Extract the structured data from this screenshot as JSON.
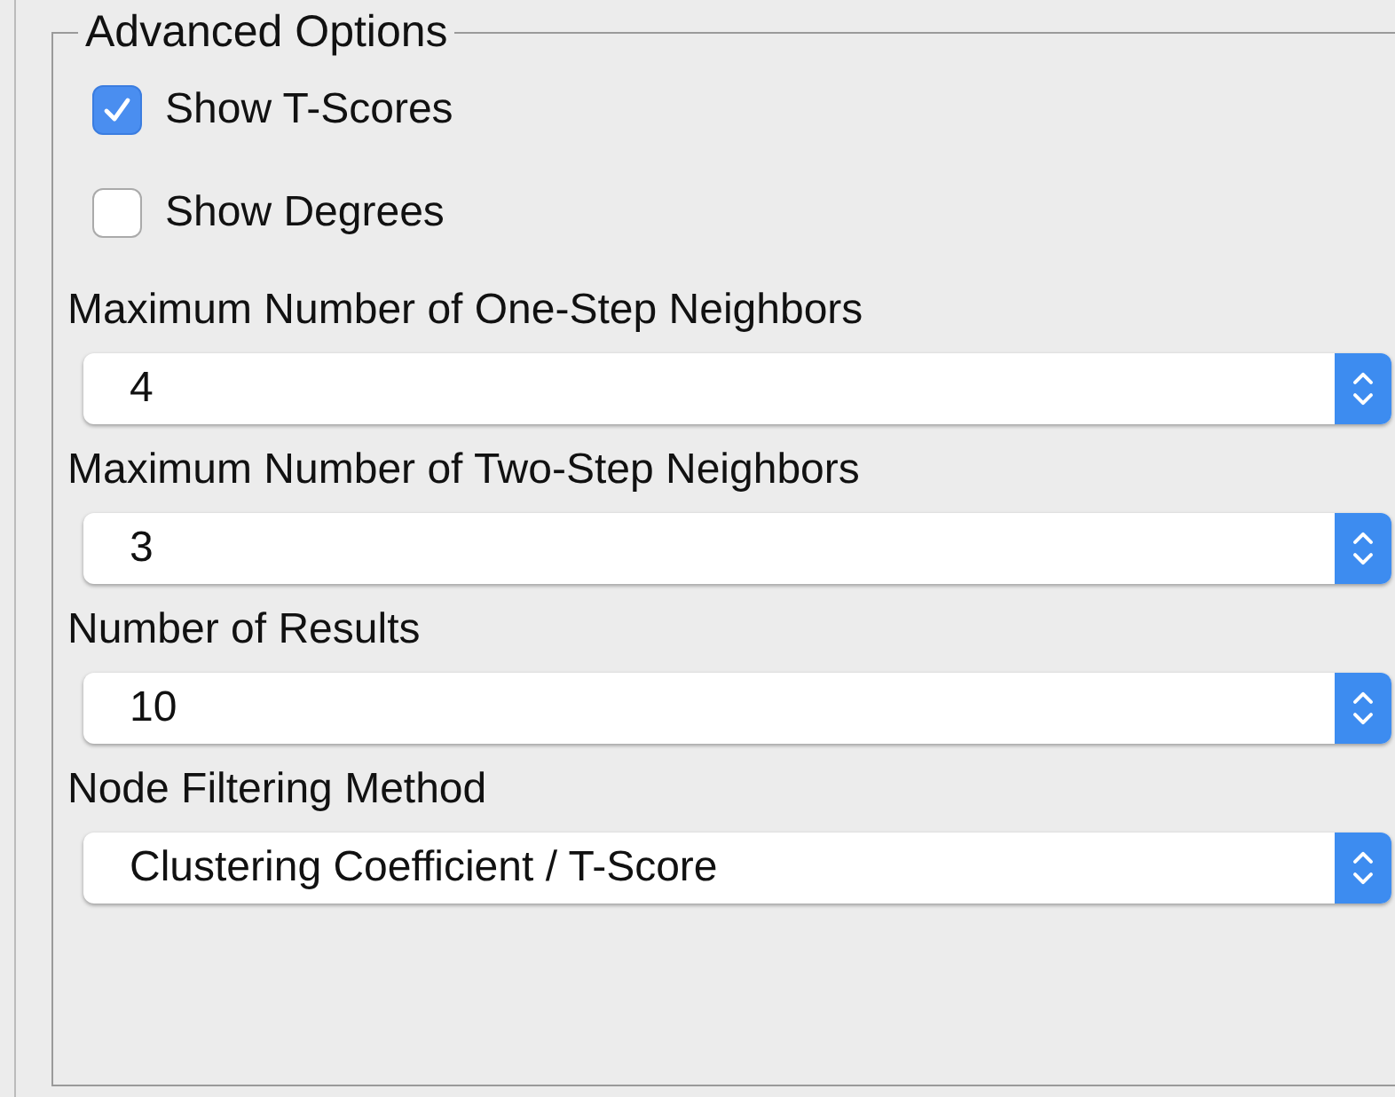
{
  "panel": {
    "title": "Advanced Options"
  },
  "checkboxes": [
    {
      "label": "Show T-Scores",
      "checked": true
    },
    {
      "label": "Show Degrees",
      "checked": false
    }
  ],
  "dropdowns": [
    {
      "label": "Maximum Number of One-Step Neighbors",
      "value": "4"
    },
    {
      "label": "Maximum Number of Two-Step Neighbors",
      "value": "3"
    },
    {
      "label": "Number of Results",
      "value": "10"
    },
    {
      "label": "Node Filtering Method",
      "value": "Clustering Coefficient / T-Score"
    }
  ]
}
